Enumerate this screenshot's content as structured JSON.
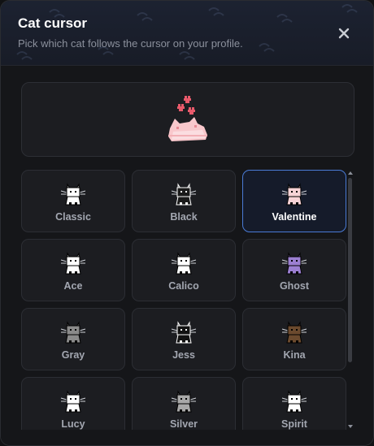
{
  "dialog": {
    "title": "Cat cursor",
    "subtitle": "Pick which cat follows the cursor on your profile."
  },
  "preview": {
    "cat": "Valentine",
    "icon": "valentine-cat-with-hearts-icon"
  },
  "selected": "Valentine",
  "cats": [
    {
      "label": "Classic",
      "color": "#ffffff"
    },
    {
      "label": "Black",
      "color": "#1a1a1a"
    },
    {
      "label": "Valentine",
      "color": "#f7d3d6"
    },
    {
      "label": "Ace",
      "color": "#ffffff"
    },
    {
      "label": "Calico",
      "color": "#ffffff"
    },
    {
      "label": "Ghost",
      "color": "#9b7fd1"
    },
    {
      "label": "Gray",
      "color": "#8a8a8a"
    },
    {
      "label": "Jess",
      "color": "#111111"
    },
    {
      "label": "Kina",
      "color": "#6b4a2e"
    },
    {
      "label": "Lucy",
      "color": "#ffffff"
    },
    {
      "label": "Silver",
      "color": "#a8a8a8"
    },
    {
      "label": "Spirit",
      "color": "#ffffff"
    }
  ],
  "colors": {
    "accent": "#4a7bd6",
    "heart": "#e85a6b"
  }
}
